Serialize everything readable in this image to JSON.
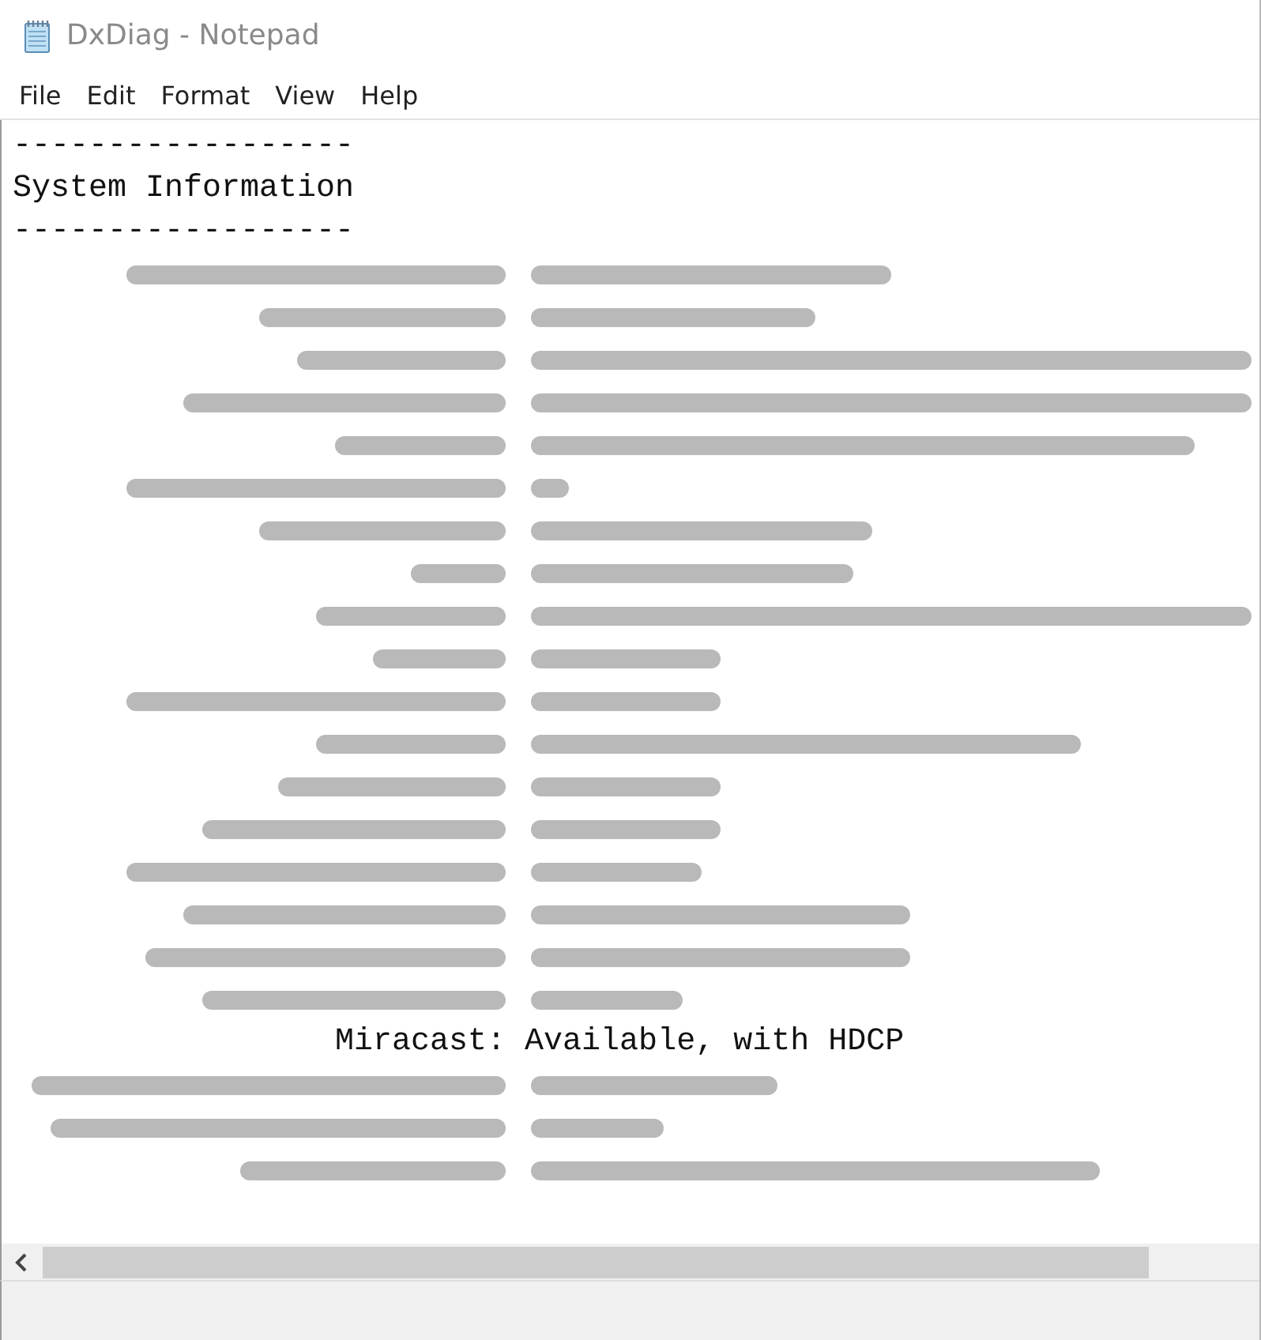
{
  "window": {
    "title": "DxDiag - Notepad"
  },
  "menu": [
    "File",
    "Edit",
    "Format",
    "View",
    "Help"
  ],
  "document": {
    "lines": [
      {
        "kind": "plain",
        "text": "------------------"
      },
      {
        "kind": "plain",
        "text": "System Information"
      },
      {
        "kind": "plain",
        "text": "------------------"
      },
      {
        "kind": "redacted"
      },
      {
        "kind": "redacted"
      },
      {
        "kind": "redacted"
      },
      {
        "kind": "redacted"
      },
      {
        "kind": "redacted"
      },
      {
        "kind": "redacted"
      },
      {
        "kind": "redacted"
      },
      {
        "kind": "redacted"
      },
      {
        "kind": "redacted"
      },
      {
        "kind": "redacted"
      },
      {
        "kind": "redacted"
      },
      {
        "kind": "redacted"
      },
      {
        "kind": "redacted"
      },
      {
        "kind": "redacted"
      },
      {
        "kind": "redacted"
      },
      {
        "kind": "redacted"
      },
      {
        "kind": "redacted"
      },
      {
        "kind": "redacted"
      },
      {
        "kind": "field",
        "key": "Miracast:",
        "value": "Available, with HDCP"
      },
      {
        "kind": "redacted"
      },
      {
        "kind": "redacted"
      },
      {
        "kind": "redacted"
      }
    ]
  }
}
